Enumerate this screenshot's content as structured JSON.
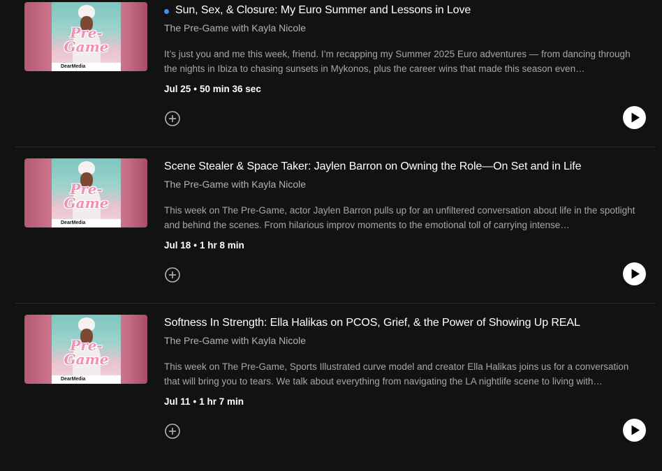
{
  "episodes": [
    {
      "is_new": true,
      "title": "Sun, Sex, & Closure: My Euro Summer and Lessons in Love",
      "show": "The Pre-Game with Kayla Nicole",
      "description": "It’s just you and me this week, friend. I’m recapping my Summer 2025 Euro adventures — from dancing through the nights in Ibiza to chasing sunsets in Mykonos, plus the career wins that made this season even…",
      "date": "Jul 25",
      "duration": "50 min 36 sec",
      "cover_title": "Pre-Game",
      "cover_badge": "DearMedia"
    },
    {
      "is_new": false,
      "title": "Scene Stealer & Space Taker: Jaylen Barron on Owning the Role—On Set and in Life",
      "show": "The Pre-Game with Kayla Nicole",
      "description": "This week on The Pre-Game, actor Jaylen Barron pulls up for an unfiltered conversation about life in the spotlight and behind the scenes. From hilarious improv moments to the emotional toll of carrying intense…",
      "date": "Jul 18",
      "duration": "1 hr 8 min",
      "cover_title": "Pre-Game",
      "cover_badge": "DearMedia"
    },
    {
      "is_new": false,
      "title": "Softness In Strength: Ella Halikas on PCOS, Grief, & the Power of Showing Up REAL",
      "show": "The Pre-Game with Kayla Nicole",
      "description": "This week on The Pre-Game, Sports Illustrated curve model and creator Ella Halikas joins us for a conversation that will bring you to tears. We talk about everything from navigating the LA nightlife scene to living with…",
      "date": "Jul 11",
      "duration": "1 hr 7 min",
      "cover_title": "Pre-Game",
      "cover_badge": "DearMedia"
    }
  ],
  "separator": "•",
  "icons": {
    "add": "plus-circle-icon",
    "play": "play-icon",
    "new": "new-episode-dot"
  },
  "colors": {
    "background": "#121212",
    "new_dot": "#3d91f4",
    "title": "#ffffff",
    "secondary": "#b3b3b3"
  }
}
